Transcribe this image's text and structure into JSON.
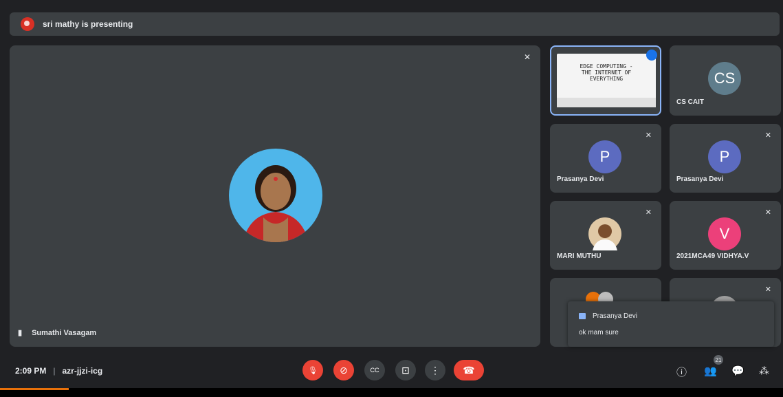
{
  "banner": {
    "text": "sri mathy is presenting"
  },
  "main": {
    "name": "Sumathi Vasagam"
  },
  "presentation": {
    "line1": "EDGE COMPUTING -",
    "line2": "THE INTERNET OF",
    "line3": "EVERYTHING"
  },
  "participants": [
    {
      "initials": "CS",
      "name": "CS CAIT",
      "color": "#5f7d8c"
    },
    {
      "initials": "P",
      "name": "Prasanya Devi",
      "color": "#5c6bc0"
    },
    {
      "initials": "P",
      "name": "Prasanya Devi",
      "color": "#5c6bc0"
    },
    {
      "initials": "",
      "name": "MARI MUTHU",
      "color": "#e0c9a6"
    },
    {
      "initials": "V",
      "name": "2021MCA49 VIDHYA.V",
      "color": "#ec407a"
    }
  ],
  "chat": {
    "sender": "Prasanya Devi",
    "message": "ok mam sure"
  },
  "meeting": {
    "time": "2:09 PM",
    "separator": "|",
    "code": "azr-jjzi-icg"
  },
  "people_count": "21",
  "icons": {
    "mic_off": "🎙",
    "cam_off": "⊘",
    "cc": "CC",
    "present": "⊡",
    "more": "⋮",
    "hangup": "☎",
    "info": "ⓘ",
    "people": "👥",
    "chat": "💬",
    "activities": "⁂"
  }
}
